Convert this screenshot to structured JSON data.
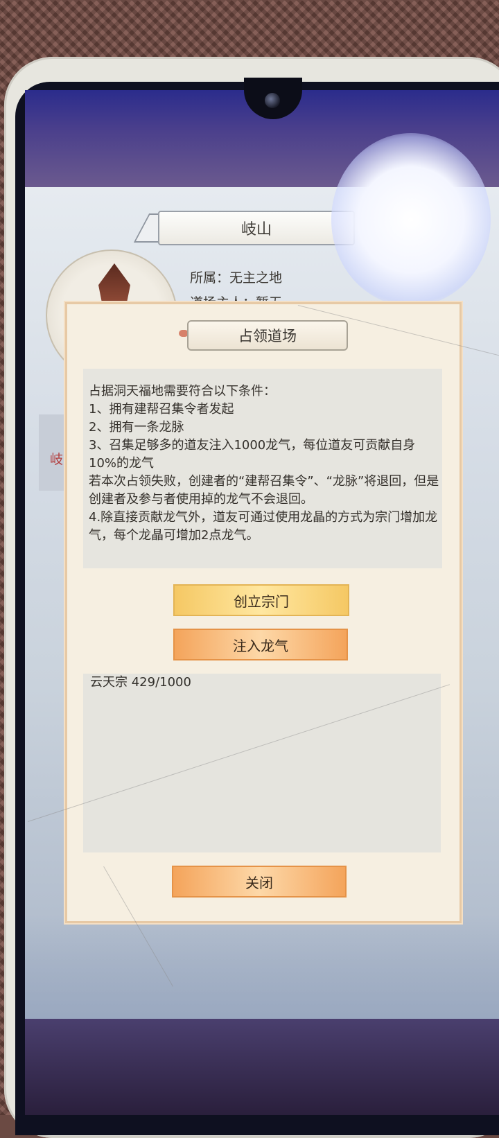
{
  "location": {
    "title": "岐山",
    "owner_line": "所属：无主之地",
    "host_line": "道场主人：暂无",
    "side_label": "岐"
  },
  "dialog": {
    "title": "占领道场",
    "rules": "占据洞天福地需要符合以下条件：\n1、拥有建帮召集令者发起\n2、拥有一条龙脉\n3、召集足够多的道友注入1000龙气，每位道友可贡献自身10%的龙气\n若本次占领失败，创建者的“建帮召集令”、“龙脉”将退回，但是创建者及参与者使用掉的龙气不会退回。\n4.除直接贡献龙气外，道友可通过使用龙晶的方式为宗门增加龙气，每个龙晶可增加2点龙气。",
    "create_button": "创立宗门",
    "inject_button": "注入龙气",
    "sect_entries": [
      "云天宗 429/1000"
    ],
    "close_button": "关闭"
  },
  "colors": {
    "dialog_bg": "#f6efe1",
    "button_gold": "#f5c864",
    "button_orange": "#f4a45b",
    "accent_red": "#b23b3b"
  }
}
